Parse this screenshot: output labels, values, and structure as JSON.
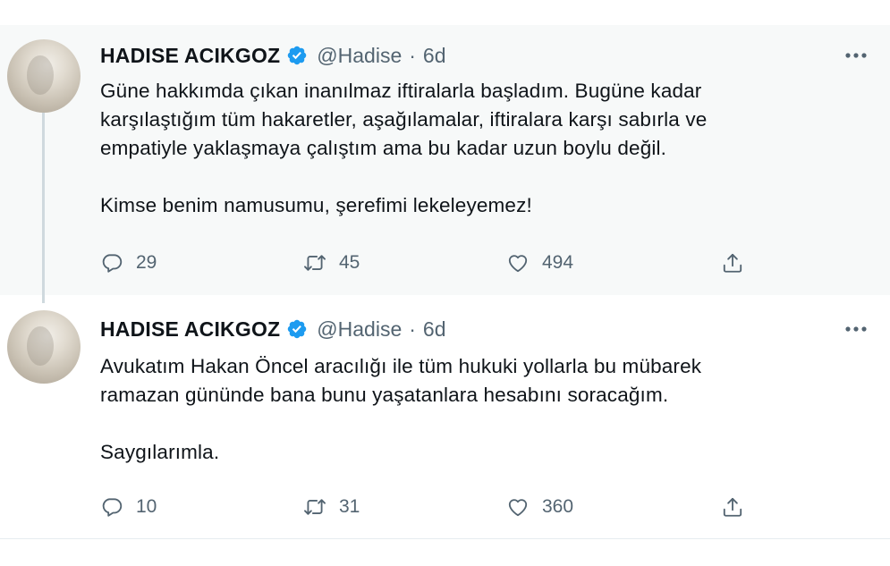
{
  "tweets": [
    {
      "author_name": "HADISE ACIKGOZ",
      "handle": "@Hadise",
      "separator": "·",
      "time": "6d",
      "text": "Güne hakkımda çıkan inanılmaz iftiralarla başladım. Bugüne kadar\nkarşılaştığım tüm hakaretler, aşağılamalar, iftiralara karşı sabırla ve\nempatiyle yaklaşmaya çalıştım ama bu kadar uzun boylu değil.\n\nKimse benim namusumu, şerefimi lekeleyemez!",
      "replies": "29",
      "retweets": "45",
      "likes": "494"
    },
    {
      "author_name": "HADISE ACIKGOZ",
      "handle": "@Hadise",
      "separator": "·",
      "time": "6d",
      "text": "Avukatım Hakan Öncel aracılığı ile tüm hukuki yollarla bu mübarek\nramazan gününde bana bunu yaşatanlara hesabını soracağım.\n\nSaygılarımla.",
      "replies": "10",
      "retweets": "31",
      "likes": "360"
    }
  ],
  "icons": {
    "verified": "verified-badge-icon",
    "more": "more-horizontal-icon",
    "reply": "reply-bubble-icon",
    "retweet": "retweet-icon",
    "like": "heart-icon",
    "share": "share-upload-icon"
  },
  "colors": {
    "verified": "#1d9bf0",
    "muted": "#536471",
    "text": "#0f1419",
    "first_tweet_background": "#f7f9f9",
    "thread_line": "#cfd9de"
  }
}
